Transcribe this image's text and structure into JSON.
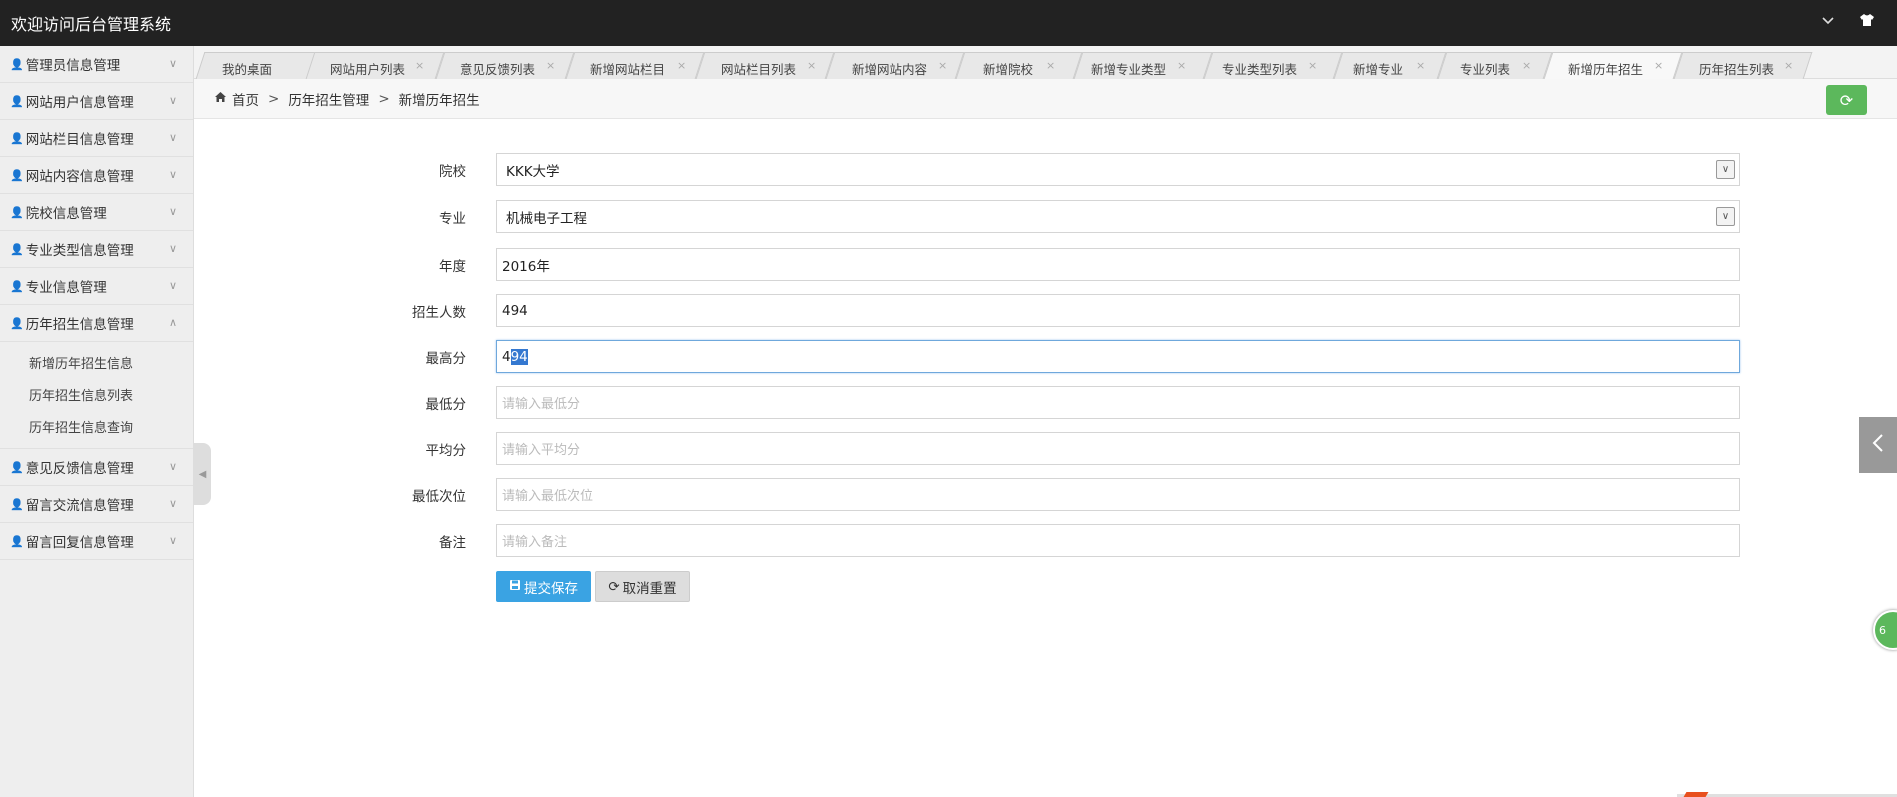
{
  "header": {
    "title": "欢迎访问后台管理系统",
    "chevron_icon": "chevron-down-icon",
    "shirt_icon": "shirt-icon"
  },
  "sidebar": {
    "items": [
      {
        "label": "管理员信息管理"
      },
      {
        "label": "网站用户信息管理"
      },
      {
        "label": "网站栏目信息管理"
      },
      {
        "label": "网站内容信息管理"
      },
      {
        "label": "院校信息管理"
      },
      {
        "label": "专业类型信息管理"
      },
      {
        "label": "专业信息管理"
      },
      {
        "label": "历年招生信息管理"
      },
      {
        "label": "意见反馈信息管理"
      },
      {
        "label": "留言交流信息管理"
      },
      {
        "label": "留言回复信息管理"
      }
    ],
    "submenu": [
      {
        "label": "新增历年招生信息"
      },
      {
        "label": "历年招生信息列表"
      },
      {
        "label": "历年招生信息查询"
      }
    ]
  },
  "tabs": [
    {
      "label": "我的桌面"
    },
    {
      "label": "网站用户列表"
    },
    {
      "label": "意见反馈列表"
    },
    {
      "label": "新增网站栏目"
    },
    {
      "label": "网站栏目列表"
    },
    {
      "label": "新增网站内容"
    },
    {
      "label": "新增院校"
    },
    {
      "label": "新增专业类型"
    },
    {
      "label": "专业类型列表"
    },
    {
      "label": "新增专业"
    },
    {
      "label": "专业列表"
    },
    {
      "label": "新增历年招生"
    },
    {
      "label": "历年招生列表"
    }
  ],
  "active_tab": "新增历年招生",
  "breadcrumb": {
    "home": "首页",
    "level1": "历年招生管理",
    "level2": "新增历年招生",
    "sep": ">"
  },
  "form": {
    "school": {
      "label": "院校",
      "value": "KKK大学"
    },
    "major": {
      "label": "专业",
      "value": "机械电子工程"
    },
    "year": {
      "label": "年度",
      "value": "2016年"
    },
    "enroll": {
      "label": "招生人数",
      "value": "494"
    },
    "max_score": {
      "label": "最高分",
      "value_prefix": "4",
      "value_selected": "94"
    },
    "min_score": {
      "label": "最低分",
      "placeholder": "请输入最低分"
    },
    "avg_score": {
      "label": "平均分",
      "placeholder": "请输入平均分"
    },
    "min_rank": {
      "label": "最低次位",
      "placeholder": "请输入最低次位"
    },
    "remark": {
      "label": "备注",
      "placeholder": "请输入备注"
    }
  },
  "buttons": {
    "submit": "提交保存",
    "reset": "取消重置"
  },
  "float_badge": "6"
}
